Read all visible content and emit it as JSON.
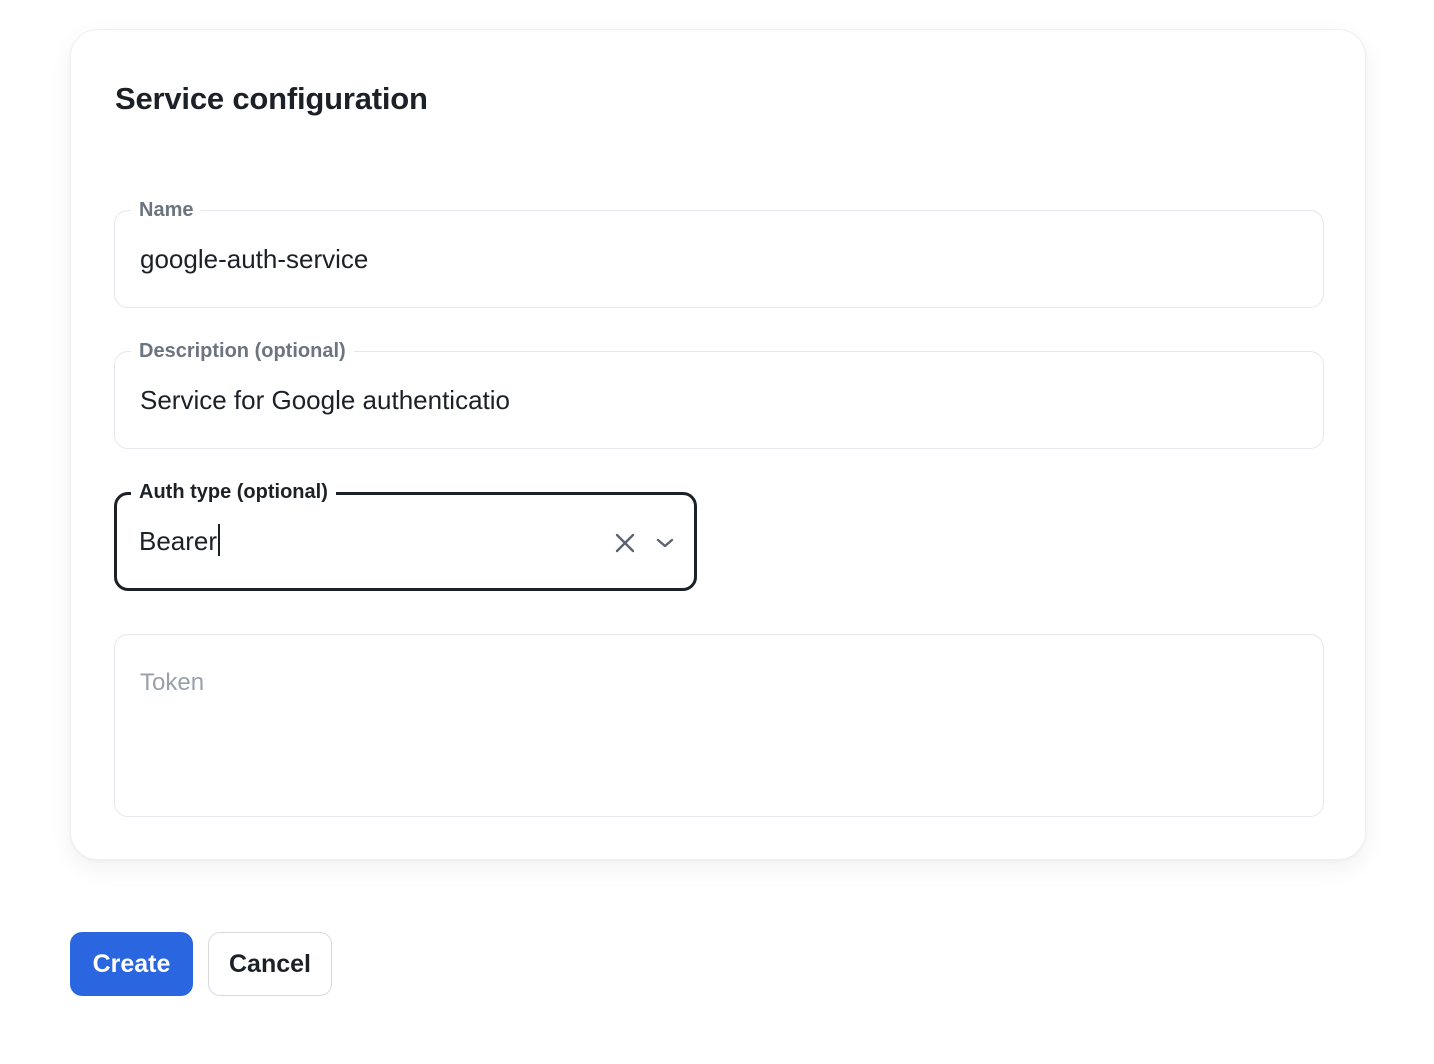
{
  "form": {
    "title": "Service configuration",
    "name": {
      "label": "Name",
      "value": "google-auth-service"
    },
    "description": {
      "label": "Description (optional)",
      "value": "Service for Google authenticatio"
    },
    "auth_type": {
      "label": "Auth type (optional)",
      "value": "Bearer",
      "clear_icon": "close-icon",
      "dropdown_icon": "chevron-down-icon"
    },
    "token": {
      "placeholder": "Token",
      "value": ""
    }
  },
  "actions": {
    "create_label": "Create",
    "cancel_label": "Cancel"
  },
  "colors": {
    "primary": "#2a66e0",
    "text": "#1c2128",
    "label": "#6b7480",
    "placeholder": "#98a1ab",
    "border": "#e4e7eb"
  }
}
